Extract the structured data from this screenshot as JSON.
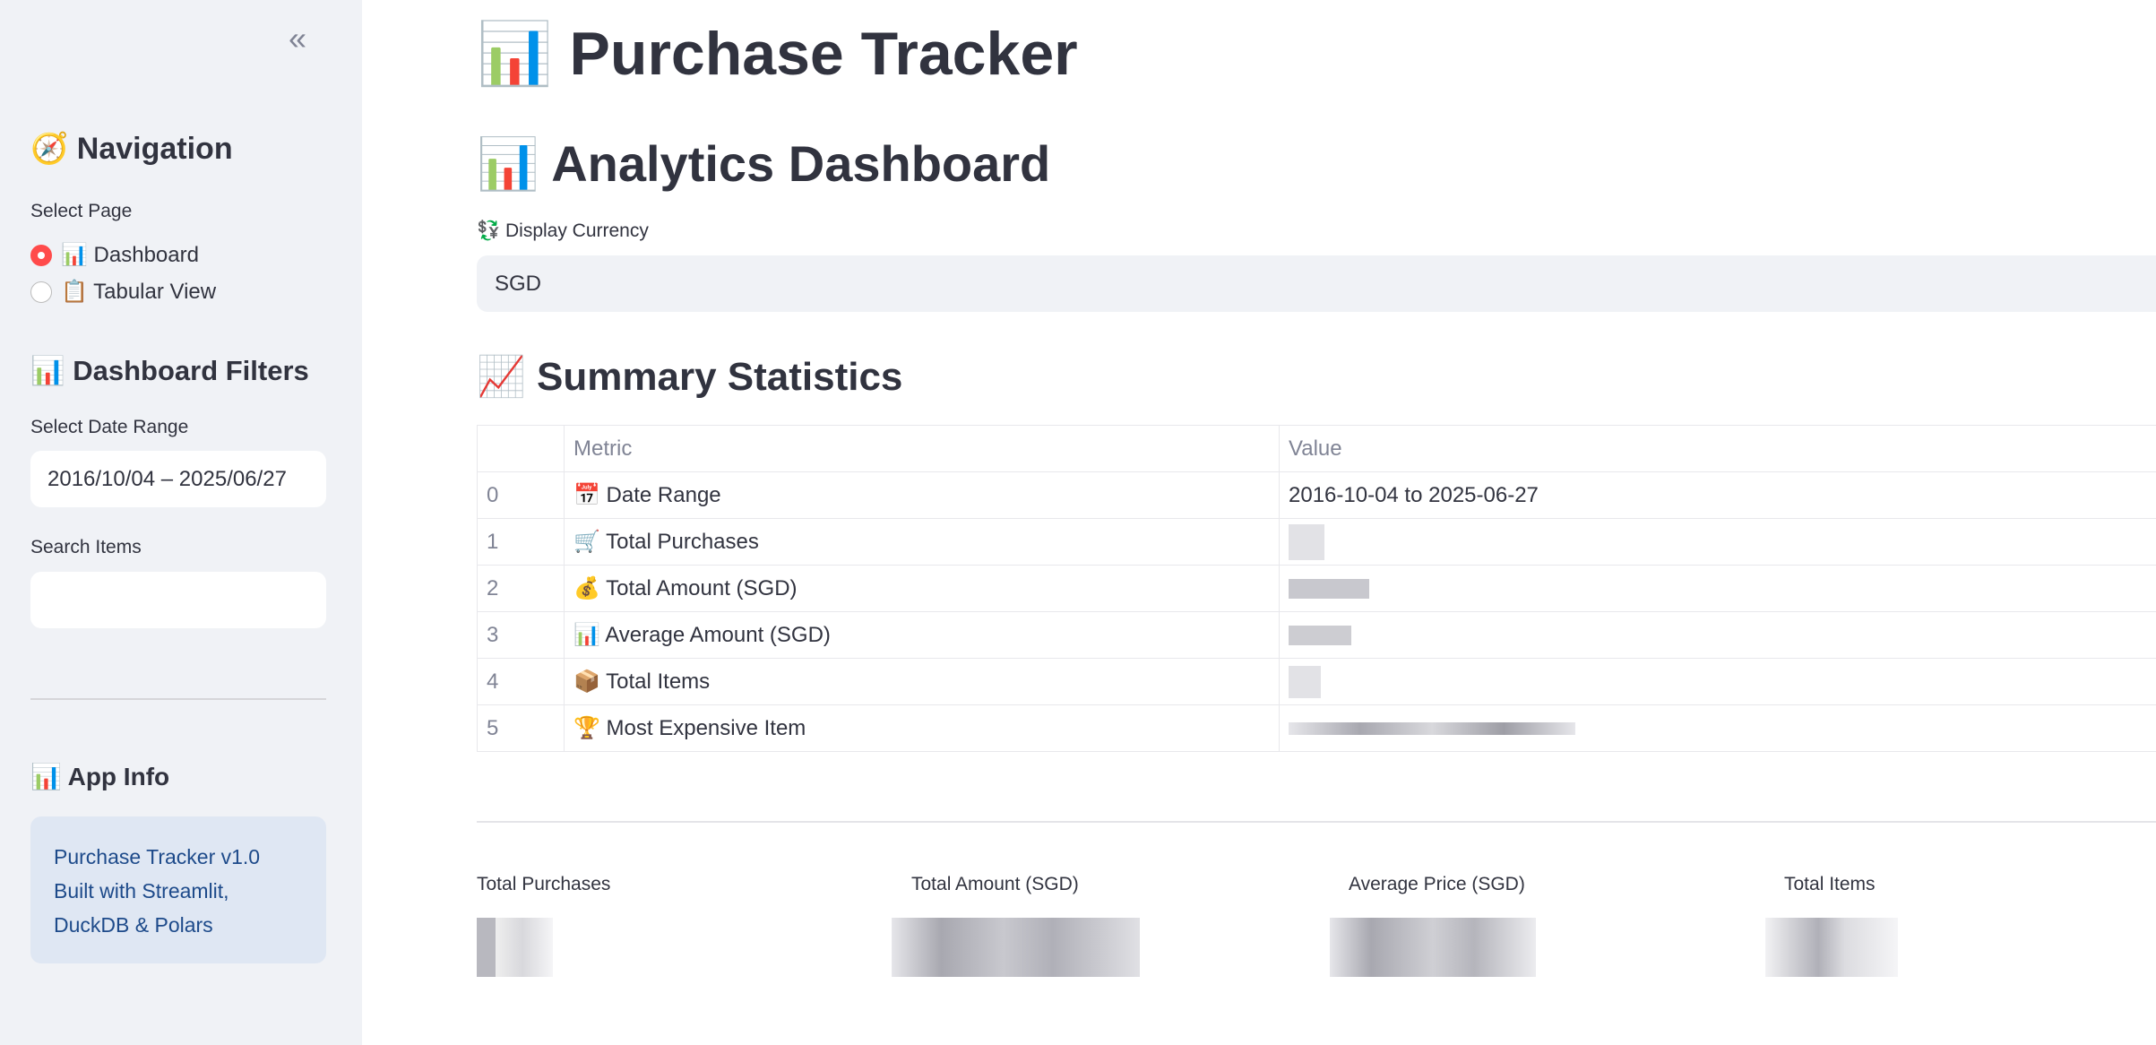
{
  "sidebar": {
    "collapse_icon": "double-chevron-left",
    "nav_heading": "🧭 Navigation",
    "select_page_label": "Select Page",
    "pages": [
      {
        "label": "📊 Dashboard",
        "selected": true
      },
      {
        "label": "📋 Tabular View",
        "selected": false
      }
    ],
    "filters_heading": "📊 Dashboard Filters",
    "date_range_label": "Select Date Range",
    "date_range_value": "2016/10/04 – 2025/06/27",
    "search_label": "Search Items",
    "search_value": "",
    "app_info_heading": "📊 App Info",
    "app_info_lines": [
      "Purchase Tracker v1.0",
      "Built with Streamlit,",
      "DuckDB & Polars"
    ]
  },
  "main": {
    "title": "📊 Purchase Tracker",
    "subtitle": "📊 Analytics Dashboard",
    "currency_label": "💱 Display Currency",
    "currency_value": "SGD",
    "summary_heading": "📈 Summary Statistics",
    "table": {
      "columns": [
        "",
        "Metric",
        "Value"
      ],
      "rows": [
        {
          "index": "0",
          "metric": "📅 Date Range",
          "value": "2016-10-04 to 2025-06-27"
        },
        {
          "index": "1",
          "metric": "🛒 Total Purchases",
          "value": ""
        },
        {
          "index": "2",
          "metric": "💰 Total Amount (SGD)",
          "value": ""
        },
        {
          "index": "3",
          "metric": "📊 Average Amount (SGD)",
          "value": ""
        },
        {
          "index": "4",
          "metric": "📦 Total Items",
          "value": ""
        },
        {
          "index": "5",
          "metric": "🏆 Most Expensive Item",
          "value": ""
        }
      ]
    },
    "metrics": [
      {
        "label": "Total Purchases"
      },
      {
        "label": "Total Amount (SGD)"
      },
      {
        "label": "Average Price (SGD)"
      },
      {
        "label": "Total Items"
      }
    ]
  },
  "colors": {
    "accent": "#ff4b4b",
    "sidebar_bg": "#f0f2f6",
    "info_bg": "#dfe7f3",
    "info_text": "#1d4a8a"
  }
}
